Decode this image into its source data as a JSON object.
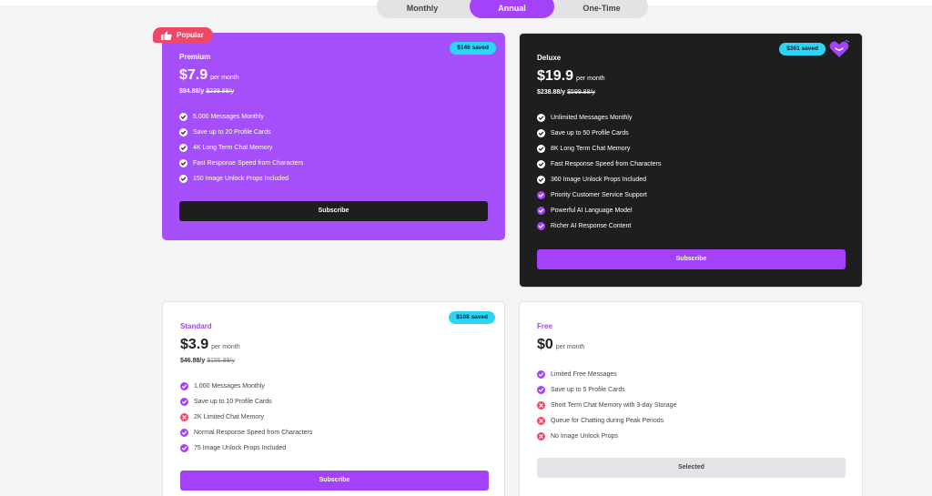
{
  "tabs": [
    {
      "label": "Monthly"
    },
    {
      "label": "Annual"
    },
    {
      "label": "One-Time"
    }
  ],
  "badge": {
    "label": "Popular"
  },
  "plans": {
    "premium": {
      "name": "Premium",
      "saved": "$146 saved",
      "price": "$7.9",
      "per": "per month",
      "yearly": "$94.88/y",
      "yearly_original": "$239.88/y",
      "features": [
        "5,000 Messages Monthly",
        "Save up to 20 Profile Cards",
        "4K Long Term Chat Memory",
        "Fast Response Speed from Characters",
        "150 Image Unlock Props Included"
      ],
      "button": "Subscribe"
    },
    "deluxe": {
      "name": "Deluxe",
      "saved": "$361 saved",
      "price": "$19.9",
      "per": "per month",
      "yearly": "$238.88/y",
      "yearly_original": "$599.88/y",
      "features": [
        "Unlimited Messages Monthly",
        "Save up to 50 Profile Cards",
        "8K Long Term Chat Memory",
        "Fast Response Speed from Characters",
        "360 Image Unlock Props Included",
        "Priority Customer Service Support",
        "Powerful AI Language Model",
        "Richer AI Response Content"
      ],
      "button": "Subscribe"
    },
    "standard": {
      "name": "Standard",
      "saved": "$108 saved",
      "price": "$3.9",
      "per": "per month",
      "yearly": "$46.88/y",
      "yearly_original": "$155.88/y",
      "features": [
        "1,000 Messages Monthly",
        "Save up to 10 Profile Cards",
        "2K Limited Chat Memory",
        "Normal Response Speed from Characters",
        "75 Image Unlock Props Included"
      ],
      "button": "Subscribe"
    },
    "free": {
      "name": "Free",
      "price": "$0",
      "per": "per month",
      "features": [
        "Limited Free Messages",
        "Save up to 5 Profile Cards",
        "Short Term Chat Memory with 3-day Storage",
        "Queue for Chatting during Peak Periods",
        "No Image Unlock Props"
      ],
      "button": "Selected"
    }
  },
  "colors": {
    "accent": "#a442fa",
    "check_white": "#ffffff",
    "check_purple": "#a442fa",
    "cross_red": "#ef4766",
    "saved_badge": "#2cd4f5"
  },
  "icons": {
    "premium": [
      "check-icon",
      "check-icon",
      "check-icon",
      "check-icon",
      "check-icon"
    ],
    "deluxe": [
      "check-icon",
      "check-icon",
      "check-icon",
      "check-icon",
      "check-icon",
      "check-purple-icon",
      "check-purple-icon",
      "check-purple-icon"
    ],
    "standard": [
      "check-purple-icon",
      "check-purple-icon",
      "cross-icon",
      "check-purple-icon",
      "check-purple-icon"
    ],
    "free": [
      "check-purple-icon",
      "check-purple-icon",
      "cross-icon",
      "cross-icon",
      "cross-icon"
    ]
  }
}
